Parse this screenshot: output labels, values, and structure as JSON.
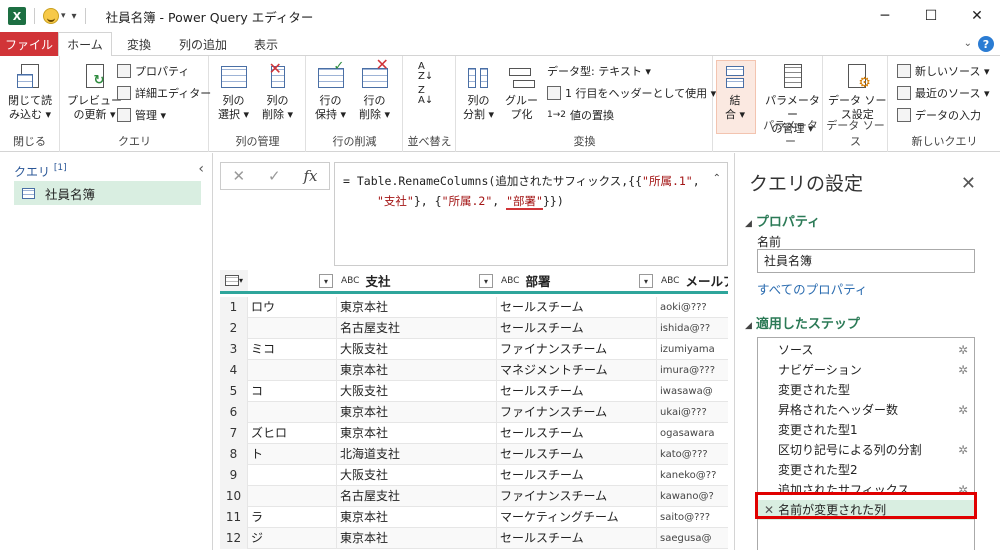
{
  "titlebar": {
    "app_icon": "X",
    "title": "社員名簿 - Power Query エディター",
    "minimize": "─",
    "maximize": "☐",
    "close": "✕"
  },
  "tabs": {
    "file": "ファイル",
    "home": "ホーム",
    "transform": "変換",
    "add_column": "列の追加",
    "view": "表示",
    "help": "?"
  },
  "ribbon": {
    "close_load_1": "閉じて読",
    "close_load_2": "み込む ▾",
    "group_close": "閉じる",
    "refresh_1": "プレビュー",
    "refresh_2": "の更新 ▾",
    "properties": "プロパティ",
    "advanced_editor": "詳細エディター",
    "manage": "管理 ▾",
    "group_query": "クエリ",
    "choose_cols_1": "列の",
    "choose_cols_2": "選択 ▾",
    "remove_cols_1": "列の",
    "remove_cols_2": "削除 ▾",
    "group_manage_cols": "列の管理",
    "keep_rows_1": "行の",
    "keep_rows_2": "保持 ▾",
    "remove_rows_1": "行の",
    "remove_rows_2": "削除 ▾",
    "group_reduce_rows": "行の削減",
    "group_sort": "並べ替え",
    "split_1": "列の",
    "split_2": "分割 ▾",
    "group_by_1": "グルー",
    "group_by_2": "プ化",
    "data_type": "データ型: テキスト ▾",
    "first_row_header": "1 行目をヘッダーとして使用 ▾",
    "replace_values": "値の置換",
    "group_transform": "変換",
    "merge_1": "結",
    "merge_2": "合 ▾",
    "manage_params_1": "パラメーター",
    "manage_params_2": "の管理 ▾",
    "group_params": "パラメーター",
    "ds_settings_1": "データ ソー",
    "ds_settings_2": "ス設定",
    "group_datasource": "データ ソース",
    "new_source": "新しいソース ▾",
    "recent_sources": "最近のソース ▾",
    "enter_data": "データの入力",
    "group_new_query": "新しいクエリ"
  },
  "queries": {
    "header": "クエリ",
    "count": "[1]",
    "items": [
      "社員名簿"
    ]
  },
  "formula": {
    "cancel": "✕",
    "commit": "✓",
    "fx": "fx",
    "line1_a": "= Table.RenameColumns(追加されたサフィックス,{{",
    "line1_s1": "\"所属.1\"",
    "line1_b": ",",
    "line2_s1": "\"支社\"",
    "line2_a": "}, {",
    "line2_s2": "\"所属.2\"",
    "line2_b": ", ",
    "line2_s3": "\"部署\"",
    "line2_c": "}})"
  },
  "grid": {
    "columns": [
      "",
      "支社",
      "部署",
      "メールア"
    ],
    "abc": "ABC",
    "rows": [
      {
        "n": "1",
        "c0": "ロウ",
        "c1": "東京本社",
        "c2": "セールスチーム",
        "c3": "aoki@???"
      },
      {
        "n": "2",
        "c0": "",
        "c1": "名古屋支社",
        "c2": "セールスチーム",
        "c3": "ishida@??"
      },
      {
        "n": "3",
        "c0": "ミコ",
        "c1": "大阪支社",
        "c2": "ファイナンスチーム",
        "c3": "izumiyama"
      },
      {
        "n": "4",
        "c0": "",
        "c1": "東京本社",
        "c2": "マネジメントチーム",
        "c3": "imura@???"
      },
      {
        "n": "5",
        "c0": "コ",
        "c1": "大阪支社",
        "c2": "セールスチーム",
        "c3": "iwasawa@"
      },
      {
        "n": "6",
        "c0": "",
        "c1": "東京本社",
        "c2": "ファイナンスチーム",
        "c3": "ukai@???"
      },
      {
        "n": "7",
        "c0": "ズヒロ",
        "c1": "東京本社",
        "c2": "セールスチーム",
        "c3": "ogasawara"
      },
      {
        "n": "8",
        "c0": "ト",
        "c1": "北海道支社",
        "c2": "セールスチーム",
        "c3": "kato@???"
      },
      {
        "n": "9",
        "c0": "",
        "c1": "大阪支社",
        "c2": "セールスチーム",
        "c3": "kaneko@??"
      },
      {
        "n": "10",
        "c0": "",
        "c1": "名古屋支社",
        "c2": "ファイナンスチーム",
        "c3": "kawano@?"
      },
      {
        "n": "11",
        "c0": "ラ",
        "c1": "東京本社",
        "c2": "マーケティングチーム",
        "c3": "saito@???"
      },
      {
        "n": "12",
        "c0": "ジ",
        "c1": "東京本社",
        "c2": "セールスチーム",
        "c3": "saegusa@"
      }
    ]
  },
  "settings": {
    "title": "クエリの設定",
    "close": "✕",
    "properties_section": "プロパティ",
    "name_label": "名前",
    "name_value": "社員名簿",
    "all_properties": "すべてのプロパティ",
    "steps_section": "適用したステップ",
    "steps": [
      {
        "label": "ソース",
        "gear": true
      },
      {
        "label": "ナビゲーション",
        "gear": true
      },
      {
        "label": "変更された型",
        "gear": false
      },
      {
        "label": "昇格されたヘッダー数",
        "gear": true
      },
      {
        "label": "変更された型1",
        "gear": false
      },
      {
        "label": "区切り記号による列の分割",
        "gear": true
      },
      {
        "label": "変更された型2",
        "gear": false
      },
      {
        "label": "追加されたサフィックス",
        "gear": true
      },
      {
        "label": "名前が変更された列",
        "gear": false
      }
    ],
    "gear_glyph": "✲",
    "delete_glyph": "✕"
  },
  "colors": {
    "accent_teal": "#2ea59b",
    "file_tab": "#d13438",
    "highlight": "#e00000",
    "selected_bg": "#d9eee1"
  }
}
